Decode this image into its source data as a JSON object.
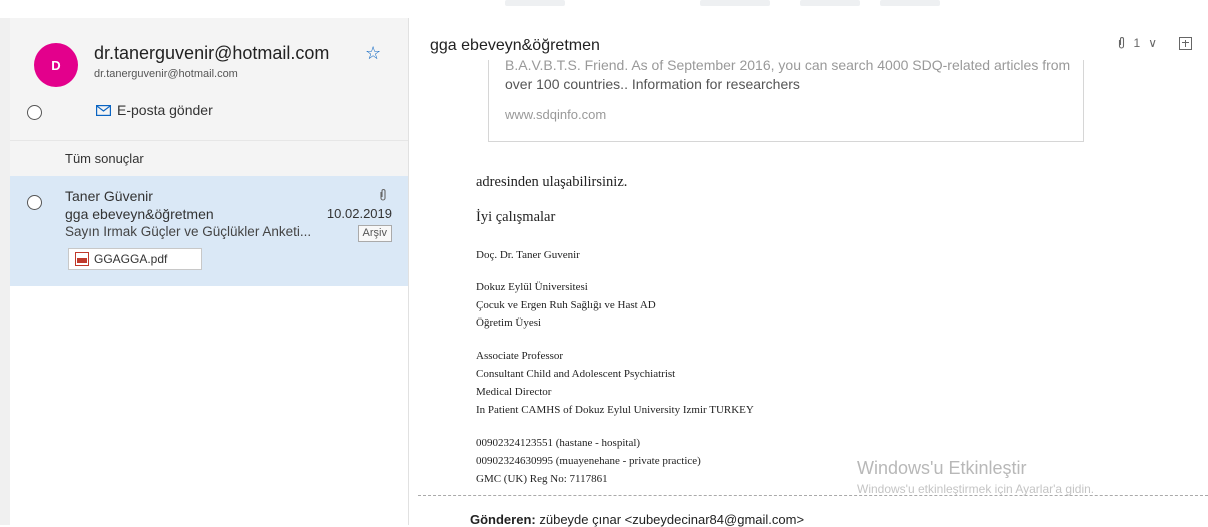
{
  "contact": {
    "avatar_letter": "D",
    "name": "dr.tanerguvenir@hotmail.com",
    "email": "dr.tanerguvenir@hotmail.com",
    "favorite_icon": "star-icon",
    "send_label": "E-posta gönder"
  },
  "results": {
    "header": "Tüm sonuçlar"
  },
  "mail_item": {
    "from": "Taner Güvenir",
    "subject": "gga ebeveyn&öğretmen",
    "date": "10.02.2019",
    "preview": "Sayın Irmak Güçler ve Güçlükler Anketi...",
    "folder": "Arşiv",
    "attachment": "GGAGGA.pdf"
  },
  "reading": {
    "subject": "gga ebeveyn&öğretmen",
    "attachment_count": "1",
    "card": {
      "clipped_line": "B.A.V.B.T.S. Friend. As of September 2016, you can search 4000 SDQ-related articles from",
      "line2": "over 100 countries.. Information for researchers",
      "url": "www.sdqinfo.com"
    },
    "body": {
      "line1": "adresinden ulaşabilirsiniz.",
      "line2": "İyi çalışmalar",
      "signature": [
        "Doç. Dr. Taner Guvenir",
        "Dokuz Eylül Üniversitesi",
        "Çocuk ve Ergen Ruh Sağlığı ve Hast AD",
        "Öğretim Üyesi",
        "Associate Professor",
        "Consultant Child and Adolescent Psychiatrist",
        "Medical Director",
        "In Patient CAMHS of Dokuz Eylul University Izmir TURKEY",
        "00902324123551 (hastane - hospital)",
        "00902324630995 (muayenehane - private practice)",
        "GMC (UK) Reg No: 7117861"
      ]
    },
    "from_label": "Gönderen:",
    "from_value": "zübeyde çınar <zubeydecinar84@gmail.com>"
  },
  "watermark": {
    "title": "Windows'u Etkinleştir",
    "subtitle": "Windows'u etkinleştirmek için Ayarlar'a gidin."
  }
}
